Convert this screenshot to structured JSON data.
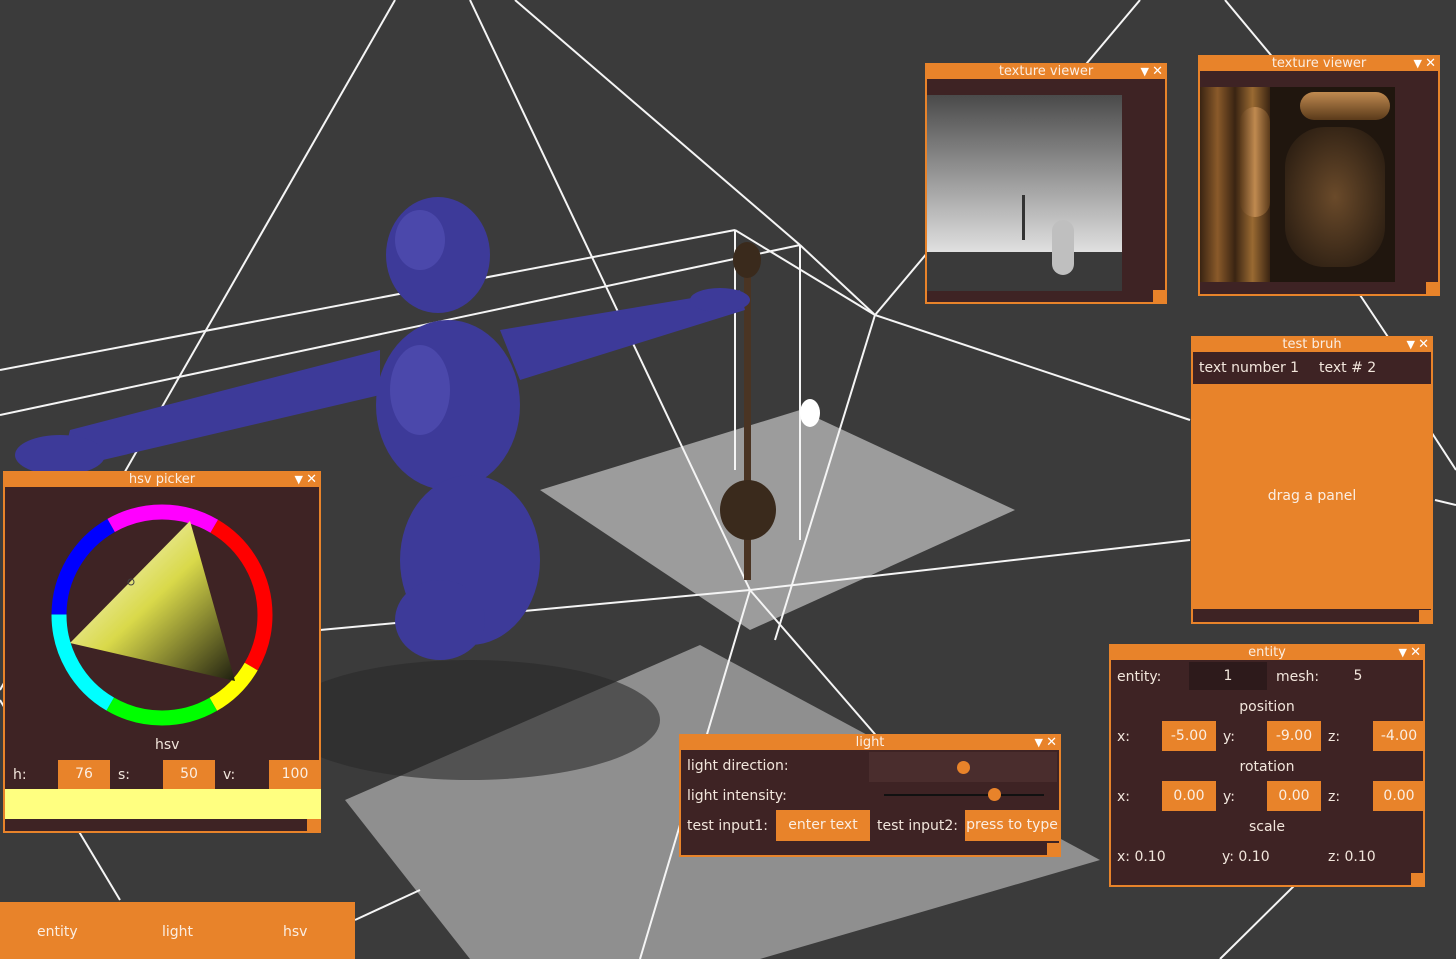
{
  "hsv_picker": {
    "title": "hsv picker",
    "mode_label": "hsv",
    "h_label": "h:",
    "h_value": "76",
    "s_label": "s:",
    "s_value": "50",
    "v_label": "v:",
    "v_value": "100",
    "preview_color": "#ffff80"
  },
  "texture_viewer_1": {
    "title": "texture viewer"
  },
  "texture_viewer_2": {
    "title": "texture viewer"
  },
  "test_bruh": {
    "title": "test bruh",
    "text1": "text number 1",
    "text2": "text # 2",
    "drag_label": "drag a panel"
  },
  "light": {
    "title": "light",
    "direction_label": "light direction:",
    "intensity_label": "light intensity:",
    "input1_label": "test input1:",
    "input1_value": "enter text",
    "input2_label": "test input2:",
    "input2_value": "press to type"
  },
  "entity": {
    "title": "entity",
    "entity_label": "entity:",
    "entity_value": "1",
    "mesh_label": "mesh:",
    "mesh_value": "5",
    "position_label": "position",
    "rotation_label": "rotation",
    "scale_label": "scale",
    "x_label": "x:",
    "y_label": "y:",
    "z_label": "z:",
    "position": {
      "x": "-5.00",
      "y": "-9.00",
      "z": "-4.00"
    },
    "rotation": {
      "x": "0.00",
      "y": "0.00",
      "z": "0.00"
    },
    "scale": {
      "x": "x: 0.10",
      "y": "y: 0.10",
      "z": "z: 0.10"
    }
  },
  "taskbar": {
    "items": [
      "entity",
      "light",
      "hsv"
    ]
  },
  "icons": {
    "minimize": "chevron-down-icon",
    "close": "close-icon"
  },
  "colors": {
    "accent": "#e8832a",
    "panel": "#3e2324",
    "background": "#3b3b3b",
    "figure": "#3d3a99"
  }
}
